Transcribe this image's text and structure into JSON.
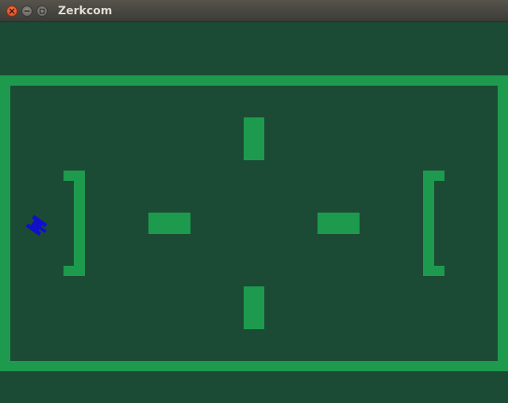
{
  "window": {
    "title": "Zerkcom",
    "buttons": [
      {
        "name": "close-button",
        "icon": "close-icon"
      },
      {
        "name": "minimize-button",
        "icon": "minimize-icon"
      },
      {
        "name": "maximize-button",
        "icon": "maximize-icon"
      }
    ]
  },
  "game": {
    "background_color": "#1b4a35",
    "wall_color": "#1d9a4e",
    "player": {
      "icon": "blue-tank-icon",
      "color": "#1010c8"
    }
  }
}
